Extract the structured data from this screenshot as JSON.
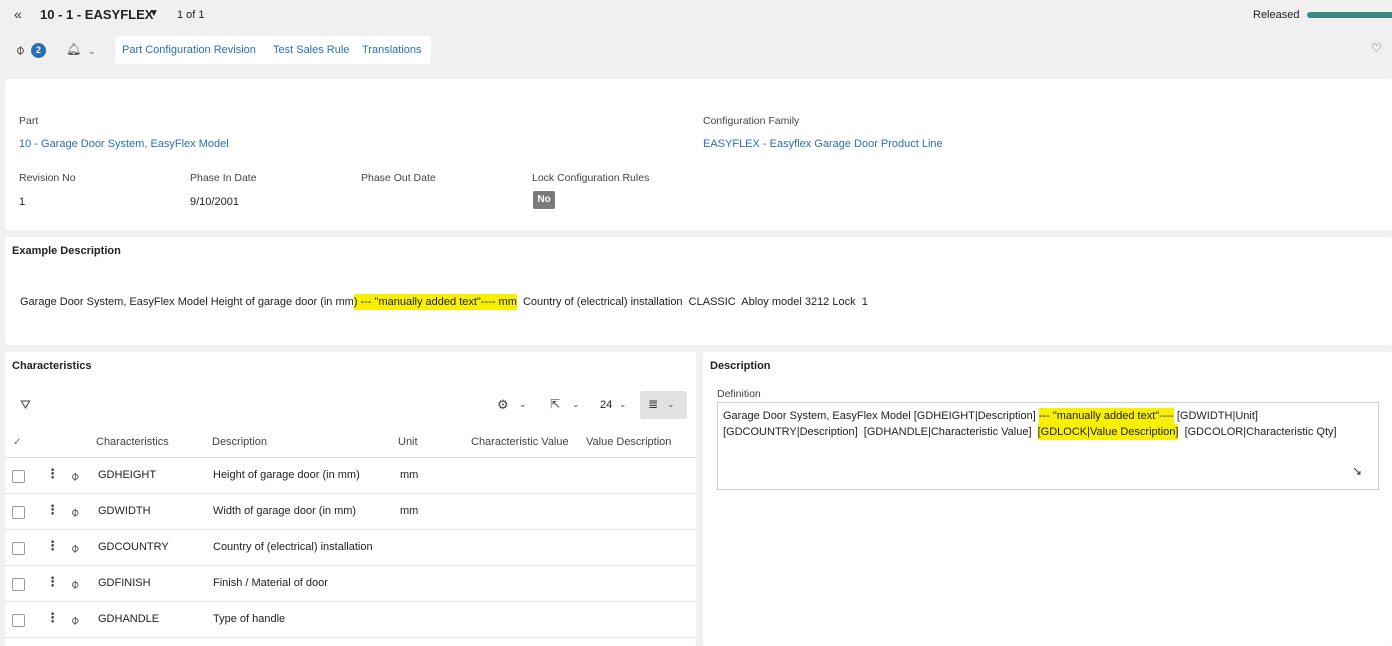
{
  "header": {
    "title": "10 - 1 - EASYFLEX",
    "pager": "1 of 1",
    "status": "Released",
    "attachments_count": "2",
    "links": [
      "Part Configuration Revision",
      "Test Sales Rule",
      "Translations"
    ]
  },
  "part_info": {
    "part_label": "Part",
    "part_value": "10 - Garage Door System, EasyFlex Model",
    "config_family_label": "Configuration Family",
    "config_family_value": "EASYFLEX - Easyflex Garage Door Product Line",
    "revision_label": "Revision No",
    "revision_value": "1",
    "phase_in_label": "Phase In Date",
    "phase_in_value": "9/10/2001",
    "phase_out_label": "Phase Out Date",
    "phase_out_value": "",
    "lock_label": "Lock Configuration Rules",
    "lock_value": "No"
  },
  "example": {
    "title": "Example Description",
    "text_a": "Garage Door System, EasyFlex Model Height of garage door (in mm",
    "text_hl": ") --- \"manually added text\"---- mm",
    "text_b": "  Country of (electrical) installation  CLASSIC  Abloy model 3212 Lock  1"
  },
  "characteristics": {
    "title": "Characteristics",
    "page_size": "24",
    "columns": [
      "Characteristics",
      "Description",
      "Unit",
      "Characteristic Value",
      "Value Description"
    ],
    "rows": [
      {
        "code": "GDHEIGHT",
        "description": "Height of garage door (in mm)",
        "unit": "mm"
      },
      {
        "code": "GDWIDTH",
        "description": "Width of garage door (in mm)",
        "unit": "mm"
      },
      {
        "code": "GDCOUNTRY",
        "description": "Country of (electrical) installation",
        "unit": ""
      },
      {
        "code": "GDFINISH",
        "description": "Finish / Material of door",
        "unit": ""
      },
      {
        "code": "GDHANDLE",
        "description": "Type of handle",
        "unit": ""
      }
    ]
  },
  "description": {
    "title": "Description",
    "definition_label": "Definition",
    "line1_a": "Garage Door System, EasyFlex Model [GDHEIGHT|Description] ",
    "line1_hl": "--- \"manually added text\"----",
    "line1_b": " [GDWIDTH|Unit]",
    "line2_a": "[GDCOUNTRY|Description]  [GDHANDLE|Characteristic Value]  ",
    "line2_hl": "[GDLOCK|Value Description]",
    "line2_b": "  [GDCOLOR|Characteristic Qty]"
  },
  "colors": {
    "accent": "#2a6fb5",
    "status": "#3a8a84",
    "highlight": "#f8f000"
  }
}
